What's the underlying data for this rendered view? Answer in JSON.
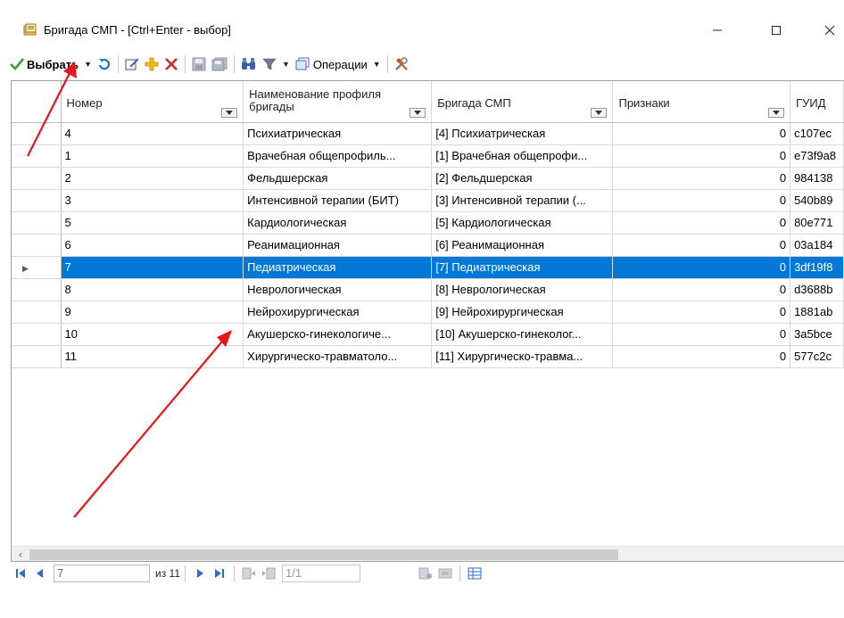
{
  "window": {
    "title": "Бригада СМП - [Ctrl+Enter - выбор]",
    "icon": "form-icon",
    "controls": {
      "minimize": "—",
      "maximize": "☐",
      "close": "✕"
    }
  },
  "toolbar": {
    "select_label": "Выбрать",
    "operations_label": "Операции",
    "icons": [
      "checkmark-icon",
      "refresh-icon",
      "edit-icon",
      "add-icon",
      "delete-icon",
      "save-icon",
      "save-all-icon",
      "search-icon",
      "filter-icon",
      "copy-icon",
      "tools-icon"
    ]
  },
  "grid": {
    "columns": [
      {
        "label": "Номер"
      },
      {
        "label": "Наименование профиля бригады"
      },
      {
        "label": "Бригада СМП"
      },
      {
        "label": "Признаки"
      },
      {
        "label": "ГУИД"
      }
    ],
    "rows": [
      {
        "number": "4",
        "profile": "Психиатрическая",
        "brigade": "[4] Психиатрическая",
        "flags": "0",
        "guid": "c107ec"
      },
      {
        "number": "1",
        "profile": "Врачебная общепрофиль...",
        "brigade": "[1] Врачебная общепрофи...",
        "flags": "0",
        "guid": "e73f9a8"
      },
      {
        "number": "2",
        "profile": "Фельдшерская",
        "brigade": "[2] Фельдшерская",
        "flags": "0",
        "guid": "984138"
      },
      {
        "number": "3",
        "profile": "Интенсивной терапии (БИТ)",
        "brigade": "[3] Интенсивной терапии (...",
        "flags": "0",
        "guid": "540b89"
      },
      {
        "number": "5",
        "profile": "Кардиологическая",
        "brigade": "[5] Кардиологическая",
        "flags": "0",
        "guid": "80e771"
      },
      {
        "number": "6",
        "profile": "Реанимационная",
        "brigade": "[6] Реанимационная",
        "flags": "0",
        "guid": "03a184"
      },
      {
        "number": "7",
        "profile": "Педиатрическая",
        "brigade": "[7] Педиатрическая",
        "flags": "0",
        "guid": "3df19f8",
        "selected": true
      },
      {
        "number": "8",
        "profile": "Неврологическая",
        "brigade": "[8] Неврологическая",
        "flags": "0",
        "guid": "d3688b"
      },
      {
        "number": "9",
        "profile": "Нейрохирургическая",
        "brigade": "[9] Нейрохирургическая",
        "flags": "0",
        "guid": "1881ab"
      },
      {
        "number": "10",
        "profile": "Акушерско-гинекологиче...",
        "brigade": "[10] Акушерско-гинеколог...",
        "flags": "0",
        "guid": "3a5bce"
      },
      {
        "number": "11",
        "profile": "Хирургическо-травматоло...",
        "brigade": "[11] Хирургическо-травма...",
        "flags": "0",
        "guid": "577c2c"
      }
    ]
  },
  "navigator": {
    "position": "7",
    "total": "из 11",
    "page": "1/1"
  },
  "colors": {
    "selection": "#0078d7",
    "annotation_arrow": "#e8161b",
    "accent_green": "#3aa02a",
    "delete_red": "#d8262b",
    "nav_blue": "#2b6cc4"
  }
}
